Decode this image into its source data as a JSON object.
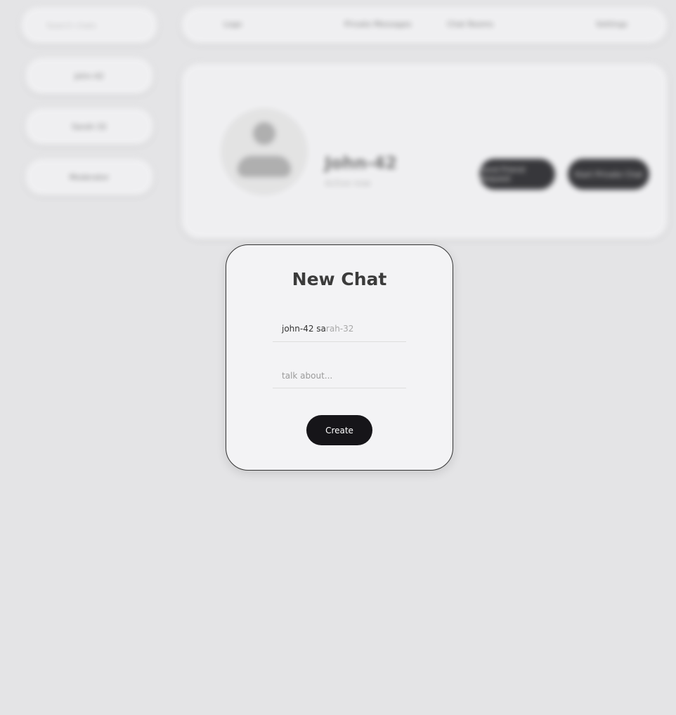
{
  "background": {
    "search_placeholder": "Search chats",
    "sidebar_items": [
      {
        "label": "John-42"
      },
      {
        "label": "Sarah-32"
      },
      {
        "label": "Moderator"
      }
    ],
    "topbar": {
      "left": "Logo",
      "mid1": "Private Messages",
      "mid2": "Chat Rooms",
      "right": "Settings"
    },
    "profile": {
      "name": "John-42",
      "subtitle": "Active now",
      "btn1": "Send Friend Request",
      "btn2": "Start Private Chat"
    }
  },
  "modal": {
    "title": "New Chat",
    "users_typed": "john-42 sa",
    "users_suggestion": "rah-32",
    "topic_placeholder": "talk about...",
    "create_label": "Create"
  },
  "colors": {
    "page_bg": "#e4e4e6",
    "card_bg": "#f3f3f5",
    "button_dark": "#161519",
    "title_text": "#3b3b3b"
  }
}
